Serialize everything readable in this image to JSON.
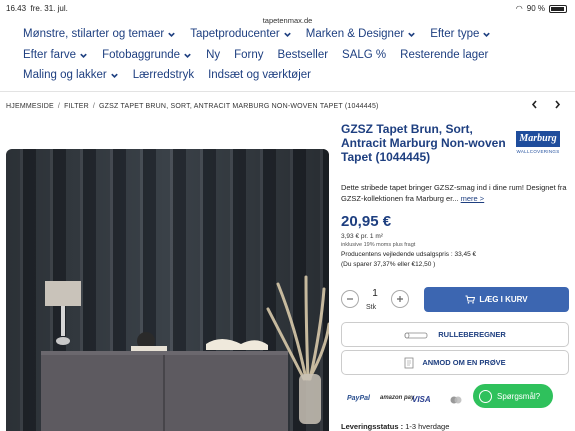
{
  "status": {
    "time": "16.43",
    "date": "fre. 31. jul.",
    "url": "tapetenmax.de",
    "battery": "90 %"
  },
  "nav": {
    "row1": [
      {
        "label": "Mønstre, stilarter og temaer",
        "dropdown": true
      },
      {
        "label": "Tapetproducenter",
        "dropdown": true
      },
      {
        "label": "Marken & Designer",
        "dropdown": true
      },
      {
        "label": "Efter type",
        "dropdown": true
      }
    ],
    "row2": [
      {
        "label": "Efter farve",
        "dropdown": true
      },
      {
        "label": "Fotobaggrunde",
        "dropdown": true
      },
      {
        "label": "Ny",
        "dropdown": false
      },
      {
        "label": "Forny",
        "dropdown": false
      },
      {
        "label": "Bestseller",
        "dropdown": false
      },
      {
        "label": "SALG %",
        "dropdown": false
      },
      {
        "label": "Resterende lager",
        "dropdown": false
      }
    ],
    "row3": [
      {
        "label": "Maling og lakker",
        "dropdown": true
      },
      {
        "label": "Lærredstryk",
        "dropdown": false
      },
      {
        "label": "Indsæt og værktøjer",
        "dropdown": false
      }
    ]
  },
  "breadcrumb": {
    "home": "HJEMMESIDE",
    "filter": "FILTER",
    "current": "GZSZ TAPET BRUN, SORT, ANTRACIT MARBURG NON-WOVEN TAPET (1044445)",
    "separator": "/"
  },
  "product": {
    "title": "GZSZ Tapet Brun, Sort, Antracit Marburg Non-woven Tapet (1044445)",
    "brand_logo": "Marburg",
    "brand_sub": "WALLCOVERINGS",
    "description": "Dette stribede tapet bringer GZSZ-smag ind i dine rum! Designet fra GZSZ-kollektionen fra Marburg er...",
    "more_link": "mere >",
    "price": "20,95 €",
    "unit_price": "3,93 € pr. 1 m²",
    "vat_note": "inklusive 19% moms plus fragt",
    "rrp": "Producentens vejledende udsalgspris : 33,45 €",
    "savings": "(Du sparer 37,37% eller €12,50 )",
    "quantity": "1",
    "quantity_unit": "Stk"
  },
  "actions": {
    "cart": "LÆG I KURV",
    "calculator": "RULLEBEREGNER",
    "sample": "ANMOD OM EN PRØVE"
  },
  "payments": [
    "PayPal",
    "amazon pay",
    "VISA",
    "Mastercard"
  ],
  "chat": "Spørgsmål?",
  "delivery": {
    "label": "Leveringsstatus :",
    "value": "1-3 hverdage"
  },
  "colors": {
    "brand_blue": "#1e3f80",
    "button_blue": "#3c66b1",
    "chat_green": "#2fc15c"
  }
}
